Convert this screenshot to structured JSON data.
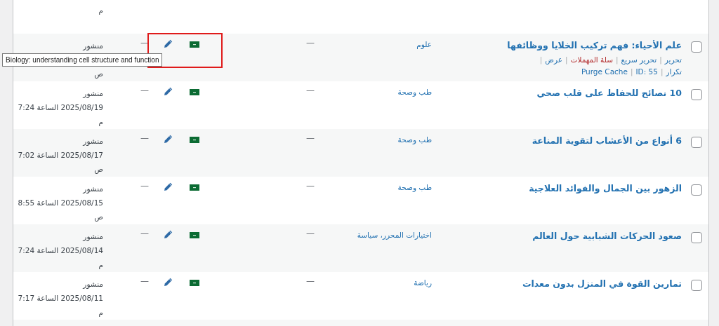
{
  "top_row": {
    "meridiem": "م"
  },
  "action_separator": "|",
  "posts": [
    {
      "title": "علم الأحياء: فهم تركيب الخلايا ووظائفها",
      "selected": false,
      "categories": "علوم",
      "tags": "—",
      "comments": "—",
      "status": "منشور",
      "meridiem": "ص",
      "highlighted": true,
      "tooltip": "Biology: understanding cell structure and function",
      "actions": [
        {
          "label": "تحرير",
          "kind": "link"
        },
        {
          "label": "تحرير سريع",
          "kind": "link"
        },
        {
          "label": "سلة المهملات",
          "kind": "delete"
        },
        {
          "label": "عرض",
          "kind": "link"
        },
        {
          "label": "تكرار",
          "kind": "link"
        },
        {
          "label": "ID: 55",
          "kind": "label"
        },
        {
          "label": "Purge Cache",
          "kind": "link"
        }
      ]
    },
    {
      "title": "10 نصائح للحفاظ على قلب صحي",
      "selected": false,
      "categories": "طب وصحة",
      "tags": "—",
      "comments": "—",
      "status": "منشور",
      "datetime": "2025/08/19 الساعة 7:24",
      "meridiem": "م",
      "highlighted": false
    },
    {
      "title": "6 أنواع من الأعشاب لتقوية المناعة",
      "selected": false,
      "categories": "طب وصحة",
      "tags": "—",
      "comments": "—",
      "status": "منشور",
      "datetime": "2025/08/17 الساعة 7:02",
      "meridiem": "ص",
      "highlighted": false
    },
    {
      "title": "الزهور بين الجمال والفوائد العلاجية",
      "selected": false,
      "categories": "طب وصحة",
      "tags": "—",
      "comments": "—",
      "status": "منشور",
      "datetime": "2025/08/15 الساعة 8:55",
      "meridiem": "ص",
      "highlighted": false
    },
    {
      "title": "صعود الحركات الشبابية حول العالم",
      "selected": false,
      "categories": "اختيارات المحرر، سياسة",
      "tags": "—",
      "comments": "—",
      "status": "منشور",
      "datetime": "2025/08/14 الساعة 7:24",
      "meridiem": "م",
      "highlighted": false
    },
    {
      "title": "تمارين القوة في المنزل بدون معدات",
      "selected": false,
      "categories": "رياضة",
      "tags": "—",
      "comments": "—",
      "status": "منشور",
      "datetime": "2025/08/11 الساعة 7:17",
      "meridiem": "م",
      "highlighted": false
    }
  ]
}
